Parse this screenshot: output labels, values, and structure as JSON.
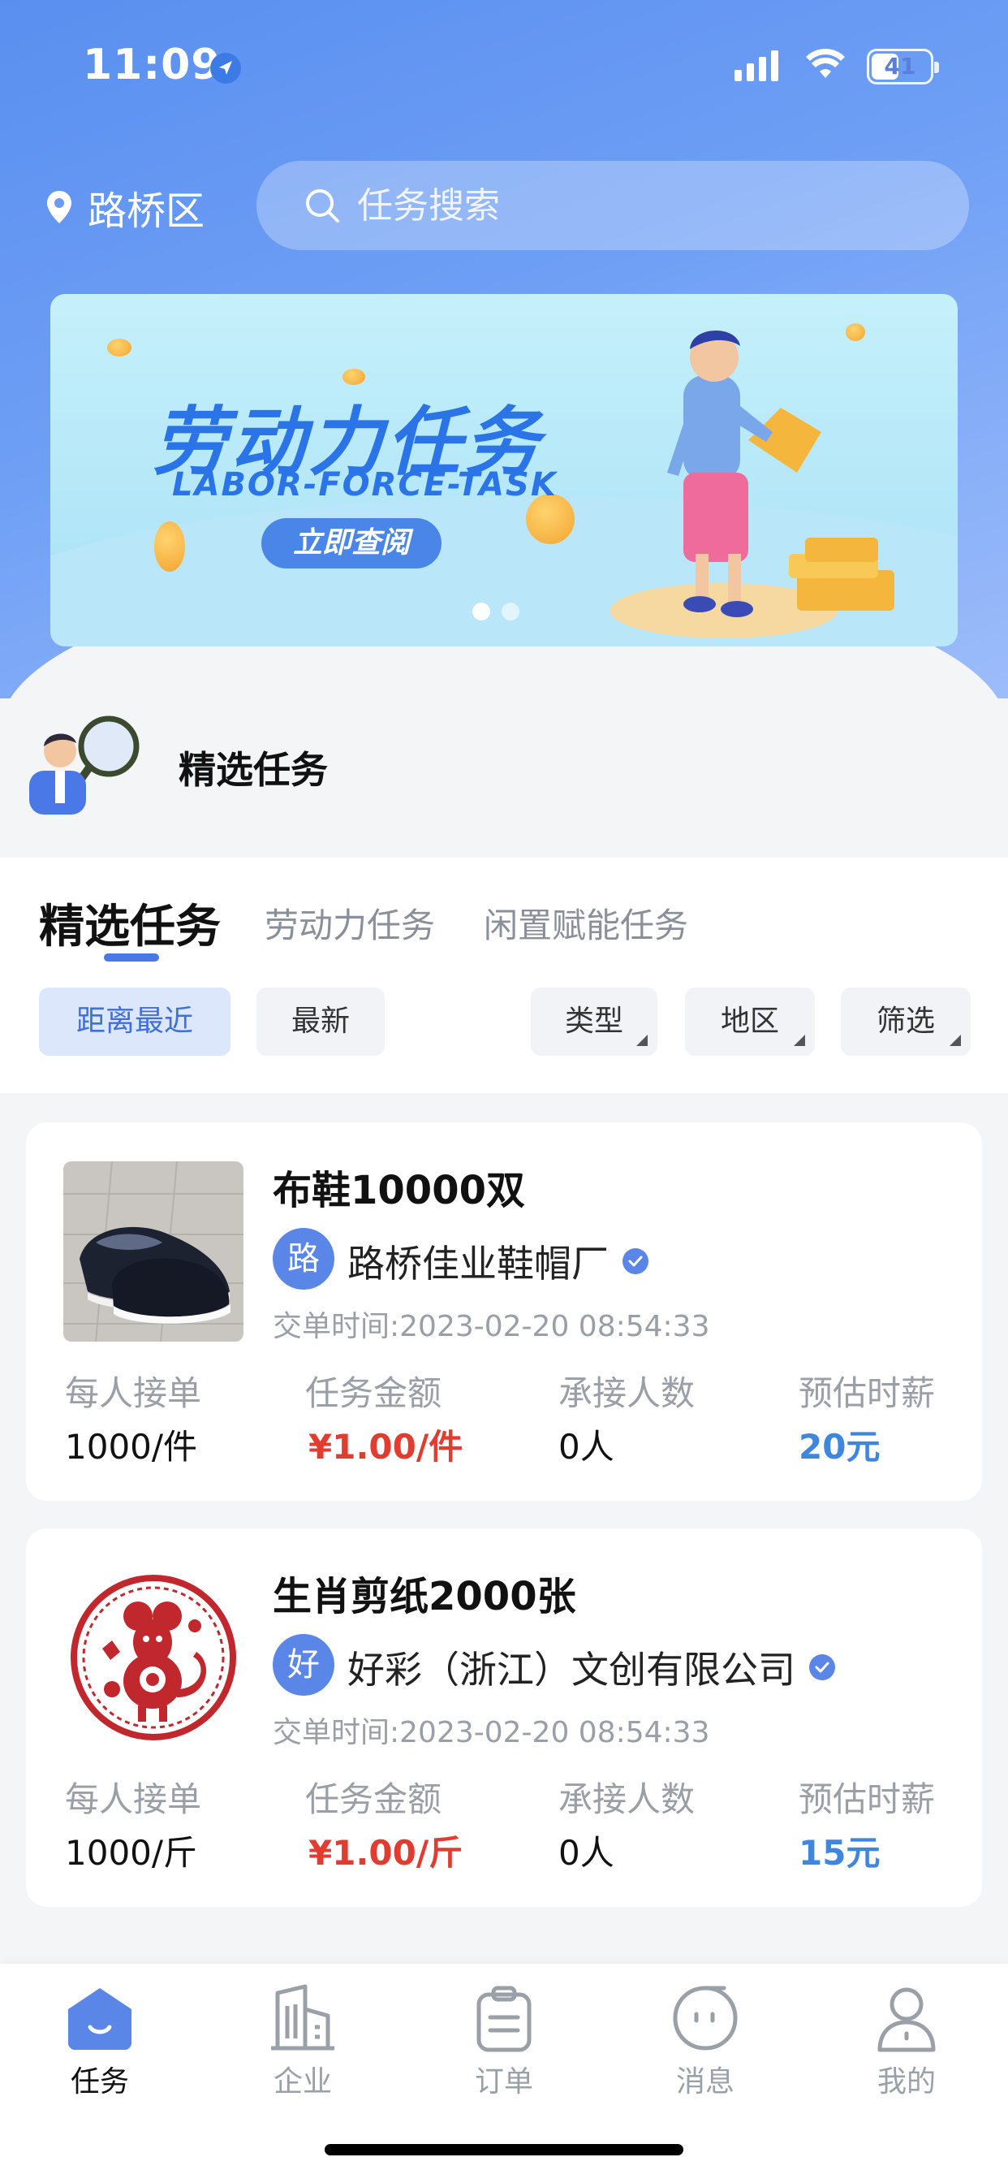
{
  "status": {
    "time": "11:09",
    "battery": "41"
  },
  "header": {
    "location": "路桥区",
    "search_placeholder": "任务搜索"
  },
  "banner": {
    "title": "劳动力任务",
    "subtitle": "LABOR-FORCE-TASK",
    "button": "立即查阅",
    "slides": 2,
    "active_slide": 1
  },
  "featured": {
    "title": "精选任务"
  },
  "tabs": [
    {
      "label": "精选任务",
      "active": true
    },
    {
      "label": "劳动力任务"
    },
    {
      "label": "闲置赋能任务"
    }
  ],
  "sort_chips": [
    {
      "label": "距离最近",
      "active": true
    },
    {
      "label": "最新"
    }
  ],
  "filter_chips": [
    {
      "label": "类型"
    },
    {
      "label": "地区"
    },
    {
      "label": "筛选"
    }
  ],
  "tasks": [
    {
      "title": "布鞋10000双",
      "company_initial": "路",
      "company": "路桥佳业鞋帽厂",
      "order_time": "交单时间:2023-02-20 08:54:33",
      "stats": [
        {
          "label": "每人接单",
          "value": "1000/件"
        },
        {
          "label": "任务金额",
          "value": "¥1.00/件"
        },
        {
          "label": "承接人数",
          "value": "0人"
        },
        {
          "label": "预估时薪",
          "value": "20元"
        }
      ]
    },
    {
      "title": "生肖剪纸2000张",
      "company_initial": "好",
      "company": "好彩（浙江）文创有限公司",
      "order_time": "交单时间:2023-02-20 08:54:33",
      "stats": [
        {
          "label": "每人接单",
          "value": "1000/斤"
        },
        {
          "label": "任务金额",
          "value": "¥1.00/斤"
        },
        {
          "label": "承接人数",
          "value": "0人"
        },
        {
          "label": "预估时薪",
          "value": "15元"
        }
      ]
    }
  ],
  "nav": [
    {
      "label": "任务",
      "icon": "task-icon",
      "active": true
    },
    {
      "label": "企业",
      "icon": "building-icon"
    },
    {
      "label": "订单",
      "icon": "clipboard-icon"
    },
    {
      "label": "消息",
      "icon": "message-icon"
    },
    {
      "label": "我的",
      "icon": "profile-icon"
    }
  ],
  "colors": {
    "primary": "#4a78e6",
    "price_red": "#e23b30",
    "wage_blue": "#3f86e0"
  }
}
